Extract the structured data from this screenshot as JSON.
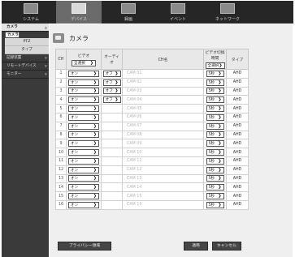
{
  "top_nav": [
    {
      "label": "システム",
      "active": false
    },
    {
      "label": "デバイス",
      "active": true
    },
    {
      "label": "録画",
      "active": false
    },
    {
      "label": "イベント",
      "active": false
    },
    {
      "label": "ネットワーク",
      "active": false
    }
  ],
  "sidebar": {
    "camera_category": "カメラ",
    "camera_items": [
      "カメラ",
      "PTZ",
      "タイプ"
    ],
    "storage": "記録装置",
    "remote": "リモートデバイス",
    "monitor": "モニター"
  },
  "page": {
    "title": "カメラ"
  },
  "table": {
    "headers": {
      "ch": "CH",
      "video": "ビデオ",
      "audio": "オーディオ",
      "name": "CH名",
      "dwell": "ビデオ切換時間",
      "type": "タイプ"
    },
    "select_all": "全選択",
    "rows": [
      {
        "ch": "1",
        "video": "オン",
        "audio": "オフ",
        "name": "CAM 01",
        "dwell": "5秒",
        "type": "AHD"
      },
      {
        "ch": "2",
        "video": "オン",
        "audio": "オフ",
        "name": "CAM 02",
        "dwell": "5秒",
        "type": "AHD"
      },
      {
        "ch": "3",
        "video": "オン",
        "audio": "オフ",
        "name": "CAM 03",
        "dwell": "5秒",
        "type": "AHD"
      },
      {
        "ch": "4",
        "video": "オン",
        "audio": "オフ",
        "name": "CAM 04",
        "dwell": "5秒",
        "type": "AHD"
      },
      {
        "ch": "5",
        "video": "オン",
        "audio": "",
        "name": "CAM 05",
        "dwell": "5秒",
        "type": "AHD"
      },
      {
        "ch": "6",
        "video": "オン",
        "audio": "",
        "name": "CAM 06",
        "dwell": "5秒",
        "type": "AHD"
      },
      {
        "ch": "7",
        "video": "オン",
        "audio": "",
        "name": "CAM 07",
        "dwell": "5秒",
        "type": "AHD"
      },
      {
        "ch": "8",
        "video": "オン",
        "audio": "",
        "name": "CAM 08",
        "dwell": "5秒",
        "type": "AHD"
      },
      {
        "ch": "9",
        "video": "オン",
        "audio": "",
        "name": "CAM 09",
        "dwell": "5秒",
        "type": "AHD"
      },
      {
        "ch": "10",
        "video": "オン",
        "audio": "",
        "name": "CAM 10",
        "dwell": "5秒",
        "type": "AHD"
      },
      {
        "ch": "11",
        "video": "オン",
        "audio": "",
        "name": "CAM 11",
        "dwell": "5秒",
        "type": "AHD"
      },
      {
        "ch": "12",
        "video": "オン",
        "audio": "",
        "name": "CAM 12",
        "dwell": "5秒",
        "type": "AHD"
      },
      {
        "ch": "13",
        "video": "オン",
        "audio": "",
        "name": "CAM 13",
        "dwell": "5秒",
        "type": "AHD"
      },
      {
        "ch": "14",
        "video": "オン",
        "audio": "",
        "name": "CAM 14",
        "dwell": "5秒",
        "type": "AHD"
      },
      {
        "ch": "15",
        "video": "オン",
        "audio": "",
        "name": "CAM 15",
        "dwell": "5秒",
        "type": "AHD"
      },
      {
        "ch": "16",
        "video": "オン",
        "audio": "",
        "name": "CAM 16",
        "dwell": "5秒",
        "type": "AHD"
      }
    ]
  },
  "buttons": {
    "privacy": "プライバシー領域",
    "apply": "適用",
    "cancel": "キャンセル"
  },
  "icons": {
    "select_arrow": "chevron-down-icon",
    "page_title_icon": "camera-icon"
  },
  "colors": {
    "top_bar": "#262626",
    "top_active": "#6b6b6b",
    "sidebar": "#3a3a3a",
    "content_bg": "#efefef",
    "button": "#454545"
  }
}
